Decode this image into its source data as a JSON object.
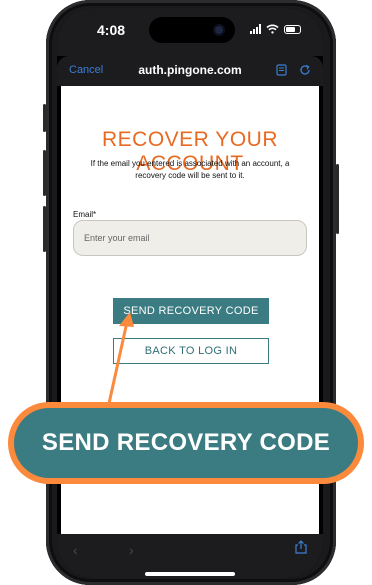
{
  "status_bar": {
    "time": "4:08"
  },
  "browser": {
    "cancel_label": "Cancel",
    "url": "auth.pingone.com"
  },
  "page": {
    "title": "RECOVER YOUR ACCOUNT",
    "subtitle": "If the email you entered is associated with an account, a recovery code will be sent to it.",
    "email_label": "Email*",
    "email_placeholder": "Enter your email",
    "email_value": "",
    "send_button": "SEND RECOVERY CODE",
    "back_button": "BACK TO LOG IN"
  },
  "callout": {
    "label": "SEND RECOVERY CODE"
  },
  "colors": {
    "accent_orange": "#e86a22",
    "teal": "#3b7c82",
    "callout_border": "#fb8a3c"
  },
  "icons": [
    "reader-icon",
    "reload-icon",
    "back-icon",
    "forward-icon",
    "share-icon"
  ]
}
